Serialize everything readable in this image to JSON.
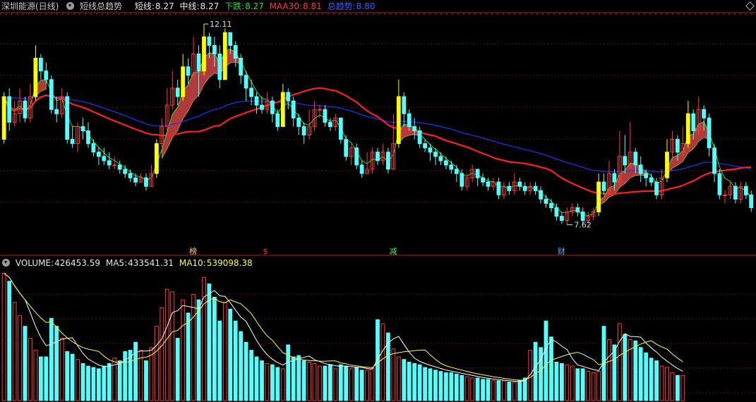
{
  "header": {
    "stock_name": "深圳能源(日线)",
    "indicator_name": "短线总趋势",
    "short_label": "短线:",
    "short_value": "8.27",
    "mid_label": "中线:",
    "mid_value": "8.27",
    "down_label": "下跌:",
    "down_value": "8.27",
    "maa30_label": "MAA30:",
    "maa30_value": "8.81",
    "trend_label": "总趋势:",
    "trend_value": "8.80"
  },
  "annotations": {
    "high_label": "12.11",
    "low_label": "7.62",
    "event_labels": [
      "榜",
      "$",
      "减",
      "财"
    ]
  },
  "volume_header": {
    "volume_label": "VOLUME:",
    "volume_value": "426453.59",
    "ma5_label": "MA5:",
    "ma5_value": "433541.31",
    "ma10_label": "MA10:",
    "ma10_value": "539098.38"
  },
  "colors": {
    "up": "#ff3a3a",
    "down": "#54ffff",
    "signal": "#ffff00",
    "maa30": "#ff2020",
    "trend": "#2233ff",
    "short": "#33dd33",
    "ribbon": "#b03a3a",
    "ma5": "#ffffff",
    "ma10": "#ffff40"
  },
  "chart_data": [
    {
      "type": "candlestick",
      "title": "深圳能源(日线)",
      "ylim": [
        7.0,
        12.5
      ],
      "candles": [
        [
          9.6,
          10.6,
          10.7,
          9.5
        ],
        [
          10.6,
          10.0,
          10.8,
          9.8
        ],
        [
          10.0,
          10.2,
          10.5,
          9.9
        ],
        [
          10.2,
          10.5,
          10.8,
          10.0
        ],
        [
          10.5,
          10.1,
          10.6,
          10.0
        ],
        [
          10.1,
          10.6,
          10.9,
          10.0
        ],
        [
          10.6,
          11.5,
          11.8,
          10.5
        ],
        [
          11.5,
          11.2,
          11.6,
          11.0
        ],
        [
          11.2,
          11.0,
          11.4,
          10.9
        ],
        [
          11.0,
          10.3,
          11.1,
          10.2
        ],
        [
          10.3,
          10.2,
          10.6,
          10.0
        ],
        [
          10.2,
          10.6,
          10.8,
          10.1
        ],
        [
          10.6,
          9.6,
          10.7,
          9.5
        ],
        [
          9.6,
          9.5,
          9.9,
          9.4
        ],
        [
          9.5,
          9.9,
          10.0,
          9.3
        ],
        [
          9.9,
          9.8,
          10.1,
          9.6
        ],
        [
          9.8,
          9.5,
          10.0,
          9.4
        ],
        [
          9.5,
          9.3,
          9.6,
          9.2
        ],
        [
          9.3,
          9.2,
          9.4,
          9.0
        ],
        [
          9.2,
          9.1,
          9.4,
          9.0
        ],
        [
          9.1,
          9.0,
          9.3,
          8.9
        ],
        [
          9.0,
          9.0,
          9.2,
          8.9
        ],
        [
          9.0,
          8.9,
          9.1,
          8.8
        ],
        [
          8.9,
          8.8,
          9.0,
          8.7
        ],
        [
          8.8,
          8.7,
          8.9,
          8.6
        ],
        [
          8.7,
          8.6,
          8.8,
          8.5
        ],
        [
          8.6,
          8.7,
          8.8,
          8.6
        ],
        [
          8.7,
          8.5,
          8.8,
          8.4
        ],
        [
          8.5,
          8.8,
          9.0,
          8.5
        ],
        [
          8.8,
          9.5,
          9.6,
          8.7
        ],
        [
          9.5,
          9.9,
          10.1,
          9.4
        ],
        [
          9.9,
          10.4,
          10.8,
          9.8
        ],
        [
          10.4,
          10.8,
          11.2,
          10.3
        ],
        [
          10.8,
          10.6,
          11.0,
          10.4
        ],
        [
          10.6,
          11.3,
          11.6,
          10.5
        ],
        [
          11.3,
          11.1,
          11.5,
          10.9
        ],
        [
          11.1,
          11.6,
          12.0,
          11.0
        ],
        [
          11.6,
          11.2,
          11.8,
          10.6
        ],
        [
          11.2,
          12.0,
          12.3,
          11.1
        ],
        [
          12.0,
          11.8,
          12.1,
          11.5
        ],
        [
          11.8,
          11.6,
          12.0,
          11.3
        ],
        [
          11.6,
          11.0,
          11.8,
          10.8
        ],
        [
          11.0,
          12.1,
          12.2,
          11.0
        ],
        [
          12.1,
          11.8,
          12.11,
          11.6
        ],
        [
          11.8,
          11.5,
          11.9,
          11.3
        ],
        [
          11.5,
          11.1,
          11.6,
          10.9
        ],
        [
          11.1,
          10.8,
          11.2,
          10.5
        ],
        [
          10.8,
          10.6,
          11.0,
          10.4
        ],
        [
          10.6,
          10.4,
          10.7,
          10.2
        ],
        [
          10.4,
          10.3,
          10.6,
          10.2
        ],
        [
          10.3,
          10.5,
          10.7,
          10.2
        ],
        [
          10.5,
          10.2,
          10.6,
          10.0
        ],
        [
          10.2,
          9.9,
          10.3,
          9.8
        ],
        [
          9.9,
          10.7,
          10.9,
          9.9
        ],
        [
          10.7,
          10.5,
          10.8,
          10.3
        ],
        [
          10.5,
          10.1,
          10.6,
          9.9
        ],
        [
          10.1,
          9.9,
          10.2,
          9.7
        ],
        [
          9.9,
          9.7,
          10.0,
          9.5
        ],
        [
          9.7,
          9.9,
          10.3,
          9.6
        ],
        [
          9.9,
          10.3,
          10.5,
          9.8
        ],
        [
          10.3,
          10.3,
          10.4,
          10.1
        ],
        [
          10.3,
          10.0,
          10.4,
          9.9
        ],
        [
          10.0,
          9.9,
          10.1,
          9.8
        ],
        [
          9.9,
          10.1,
          10.2,
          9.8
        ],
        [
          10.1,
          9.6,
          10.1,
          9.5
        ],
        [
          9.6,
          9.2,
          9.7,
          9.1
        ],
        [
          9.2,
          9.4,
          9.5,
          9.0
        ],
        [
          9.4,
          9.0,
          9.5,
          8.9
        ],
        [
          9.0,
          8.8,
          9.1,
          8.7
        ],
        [
          8.8,
          8.9,
          9.3,
          8.8
        ],
        [
          8.9,
          9.3,
          9.4,
          8.8
        ],
        [
          9.3,
          9.1,
          9.4,
          9.0
        ],
        [
          9.1,
          9.3,
          9.5,
          9.0
        ],
        [
          9.3,
          8.9,
          9.4,
          8.8
        ],
        [
          8.9,
          9.5,
          10.2,
          8.9
        ],
        [
          9.5,
          10.6,
          11.0,
          9.4
        ],
        [
          10.6,
          10.2,
          10.7,
          9.9
        ],
        [
          10.2,
          9.9,
          10.3,
          9.8
        ],
        [
          9.9,
          9.8,
          10.1,
          9.6
        ],
        [
          9.8,
          9.5,
          9.9,
          9.4
        ],
        [
          9.5,
          9.4,
          9.6,
          9.3
        ],
        [
          9.4,
          9.3,
          9.5,
          9.1
        ],
        [
          9.3,
          9.2,
          9.4,
          9.0
        ],
        [
          9.2,
          9.1,
          9.3,
          9.0
        ],
        [
          9.1,
          9.0,
          9.2,
          8.9
        ],
        [
          9.0,
          8.9,
          9.1,
          8.8
        ],
        [
          8.9,
          8.8,
          9.0,
          8.6
        ],
        [
          8.8,
          8.5,
          8.9,
          8.4
        ],
        [
          8.5,
          8.7,
          8.8,
          8.4
        ],
        [
          8.7,
          8.9,
          9.0,
          8.6
        ],
        [
          8.9,
          8.7,
          8.9,
          8.5
        ],
        [
          8.7,
          8.6,
          8.8,
          8.5
        ],
        [
          8.6,
          8.5,
          8.7,
          8.4
        ],
        [
          8.5,
          8.6,
          8.7,
          8.4
        ],
        [
          8.6,
          8.3,
          8.7,
          8.2
        ],
        [
          8.3,
          8.5,
          8.6,
          8.2
        ],
        [
          8.5,
          8.4,
          8.6,
          8.3
        ],
        [
          8.4,
          8.6,
          8.8,
          8.3
        ],
        [
          8.6,
          8.5,
          8.7,
          8.4
        ],
        [
          8.5,
          8.4,
          8.6,
          8.3
        ],
        [
          8.4,
          8.5,
          8.6,
          8.3
        ],
        [
          8.5,
          8.4,
          8.6,
          8.3
        ],
        [
          8.4,
          8.2,
          8.5,
          8.1
        ],
        [
          8.2,
          8.1,
          8.3,
          8.0
        ],
        [
          8.1,
          8.0,
          8.2,
          7.9
        ],
        [
          8.0,
          7.8,
          8.1,
          7.7
        ],
        [
          7.8,
          7.7,
          7.9,
          7.62
        ],
        [
          7.7,
          7.9,
          8.0,
          7.6
        ],
        [
          7.9,
          8.0,
          8.1,
          7.8
        ],
        [
          8.0,
          7.9,
          8.1,
          7.8
        ],
        [
          7.9,
          7.7,
          8.0,
          7.6
        ],
        [
          7.7,
          7.8,
          7.9,
          7.6
        ],
        [
          7.8,
          7.9,
          8.0,
          7.7
        ],
        [
          7.9,
          8.6,
          8.8,
          7.8
        ],
        [
          8.6,
          8.4,
          8.8,
          8.3
        ],
        [
          8.4,
          8.8,
          9.1,
          8.3
        ],
        [
          8.8,
          8.6,
          8.9,
          8.4
        ],
        [
          8.6,
          9.2,
          9.8,
          8.5
        ],
        [
          9.2,
          9.0,
          9.7,
          8.8
        ],
        [
          9.0,
          9.3,
          10.0,
          8.9
        ],
        [
          9.3,
          9.0,
          9.4,
          8.8
        ],
        [
          9.0,
          8.8,
          9.2,
          8.6
        ],
        [
          8.8,
          8.7,
          8.9,
          8.5
        ],
        [
          8.7,
          8.6,
          8.8,
          8.5
        ],
        [
          8.6,
          8.3,
          8.7,
          8.2
        ],
        [
          8.3,
          8.7,
          8.9,
          8.2
        ],
        [
          8.7,
          9.3,
          9.6,
          8.6
        ],
        [
          9.3,
          9.6,
          9.8,
          9.1
        ],
        [
          9.6,
          9.3,
          9.7,
          9.1
        ],
        [
          9.3,
          9.5,
          9.9,
          9.2
        ],
        [
          9.5,
          10.2,
          10.5,
          9.4
        ],
        [
          10.2,
          9.8,
          10.3,
          9.6
        ],
        [
          9.8,
          10.3,
          10.6,
          9.7
        ],
        [
          10.3,
          10.1,
          10.4,
          9.8
        ],
        [
          10.1,
          9.4,
          10.2,
          9.2
        ],
        [
          9.4,
          8.8,
          9.5,
          8.6
        ],
        [
          8.8,
          8.3,
          8.9,
          8.2
        ],
        [
          8.3,
          8.3,
          8.4,
          8.1
        ],
        [
          8.3,
          8.5,
          8.6,
          8.2
        ],
        [
          8.5,
          8.2,
          8.6,
          8.1
        ],
        [
          8.2,
          8.5,
          8.6,
          8.1
        ],
        [
          8.5,
          8.3,
          8.6,
          8.2
        ],
        [
          8.3,
          8.0,
          8.4,
          7.9
        ]
      ]
    },
    {
      "type": "bar",
      "title": "VOLUME",
      "unit": "lots",
      "ylim": [
        0,
        1000000
      ],
      "series": [
        {
          "name": "VOLUME",
          "values": [
            960000,
            900000,
            740000,
            640000,
            560000,
            470000,
            380000,
            330000,
            330000,
            620000,
            560000,
            470000,
            370000,
            350000,
            310000,
            280000,
            260000,
            250000,
            240000,
            260000,
            280000,
            320000,
            300000,
            370000,
            380000,
            440000,
            380000,
            300000,
            400000,
            560000,
            700000,
            840000,
            820000,
            470000,
            760000,
            660000,
            800000,
            760000,
            930000,
            880000,
            780000,
            600000,
            740000,
            690000,
            600000,
            520000,
            440000,
            380000,
            330000,
            300000,
            280000,
            270000,
            250000,
            240000,
            420000,
            330000,
            340000,
            300000,
            290000,
            280000,
            260000,
            260000,
            270000,
            240000,
            270000,
            260000,
            240000,
            250000,
            230000,
            230000,
            240000,
            610000,
            580000,
            510000,
            390000,
            330000,
            310000,
            290000,
            280000,
            270000,
            250000,
            240000,
            230000,
            220000,
            210000,
            210000,
            200000,
            190000,
            180000,
            170000,
            170000,
            160000,
            160000,
            150000,
            150000,
            150000,
            140000,
            140000,
            150000,
            170000,
            380000,
            440000,
            400000,
            600000,
            480000,
            290000,
            280000,
            270000,
            260000,
            240000,
            240000,
            220000,
            210000,
            220000,
            560000,
            460000,
            420000,
            580000,
            500000,
            460000,
            450000,
            400000,
            360000,
            320000,
            300000,
            260000,
            250000,
            210000,
            190000,
            190000
          ]
        },
        {
          "name": "MA5",
          "values": []
        },
        {
          "name": "MA10",
          "values": []
        }
      ]
    }
  ]
}
